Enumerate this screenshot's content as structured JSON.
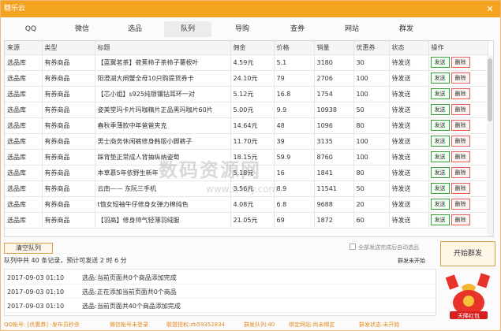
{
  "window": {
    "title": "糖乐云",
    "close": "✕"
  },
  "tabs": [
    {
      "label": "QQ"
    },
    {
      "label": "微信"
    },
    {
      "label": "选品"
    },
    {
      "label": "队列"
    },
    {
      "label": "导购"
    },
    {
      "label": "查券"
    },
    {
      "label": "网站"
    },
    {
      "label": "群发"
    }
  ],
  "active_tab": "队列",
  "table": {
    "headers": [
      "来源",
      "类型",
      "标题",
      "佣金",
      "价格",
      "销量",
      "优惠券",
      "状态",
      "操作"
    ],
    "rows": [
      [
        "选品库",
        "有券商品",
        "【蓝翼茗茶】荷蕉柿子茶柿子薯根叶",
        "4.59元",
        "5.1",
        "3180",
        "30",
        "待发送"
      ],
      [
        "选品库",
        "有券商品",
        "阳澄湖大闸蟹全母10只购提货券卡",
        "24.10元",
        "79",
        "2706",
        "100",
        "待发送"
      ],
      [
        "选品库",
        "有券商品",
        "【芯小姐】s925纯银镶钻耳环一对",
        "5.12元",
        "16.8",
        "1754",
        "100",
        "待发送"
      ],
      [
        "选品库",
        "有券商品",
        "姿美堂玛卡片玛咖精片正品黑玛咖片60片",
        "5.00元",
        "9.9",
        "10938",
        "50",
        "待发送"
      ],
      [
        "选品库",
        "有券商品",
        "春秋季薄款中年爸爸夹克",
        "14.64元",
        "48",
        "1096",
        "80",
        "待发送"
      ],
      [
        "选品库",
        "有券商品",
        "男士商务休闲裤修身韩版小脚裤子",
        "11.70元",
        "39",
        "3135",
        "100",
        "待发送"
      ],
      [
        "选品库",
        "有券商品",
        "踩背垫正常成人背抽纵纳姿萄",
        "18.15元",
        "59.9",
        "8760",
        "100",
        "待发送"
      ],
      [
        "选品库",
        "有券商品",
        "本草慕5年依野生新年",
        "5.18元",
        "16",
        "1841",
        "80",
        "待发送"
      ],
      [
        "选品库",
        "有券商品",
        "云南—— 东阮三手机",
        "3.56元",
        "8.9",
        "11541",
        "50",
        "待发送"
      ],
      [
        "选品库",
        "有券商品",
        "t恤女短袖牛仔修身女弹力棉纯色",
        "4.08元",
        "6.8",
        "9688",
        "20",
        "待发送"
      ],
      [
        "选品库",
        "有券商品",
        "【羽高】修身帅气轻薄羽绒服",
        "21.05元",
        "69",
        "1872",
        "60",
        "待发送"
      ]
    ],
    "send_label": "发送",
    "delete_label": "删除"
  },
  "queue": {
    "clear_label": "清空队列",
    "info": "队列中共 40 条记录，预计可发送 2 时 6 分",
    "auto_option": "全部发送完成后自动选品",
    "status": "群发未开始",
    "start_label": "开始群发"
  },
  "log": [
    {
      "time": "2017-09-03 01:10",
      "msg": "选品:当前页面共0个商品添加完成"
    },
    {
      "time": "2017-09-03 01:10",
      "msg": "选品:正在添加当前页面共0个商品"
    },
    {
      "time": "2017-09-03 01:10",
      "msg": "选品:当前页面共40个商品添加完成"
    }
  ],
  "hongbao_label": "天降红包",
  "statusbar": [
    "QQ帐号: [优惠券] -发布员秒杀",
    "微信帐号未登录",
    "联盟授权:zb59352834",
    "群发队列:40",
    "绑定网站:尚未绑定",
    "群发状态:未开始"
  ],
  "watermark": {
    "text": "数码资源网",
    "url": "www.smzy.com"
  },
  "colors": {
    "titlebar": "#f4a321",
    "send_border": "#38a038",
    "delete_border": "#e06060",
    "status_text": "#e08a1e"
  }
}
